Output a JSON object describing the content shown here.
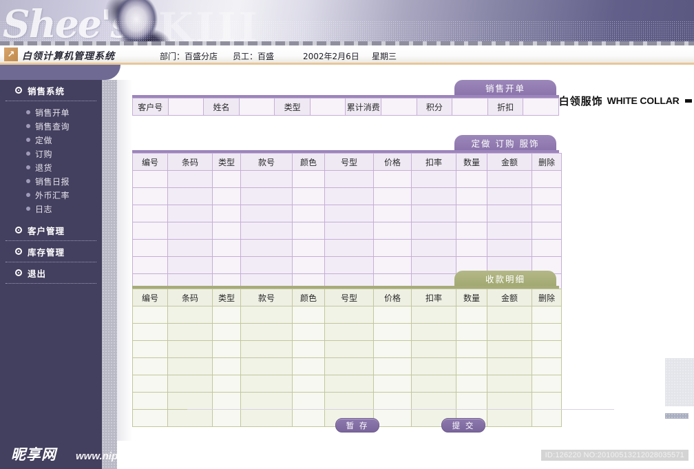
{
  "banner": {
    "script_text": "Shee's",
    "big_text": "KIII"
  },
  "header": {
    "app_title": "白领计算机管理系统",
    "department": "部门：百盛分店",
    "staff": "员工：百盛",
    "date": "2002年2月6日",
    "weekday": "星期三",
    "brand_cn": "白领服饰",
    "brand_en": "WHITE COLLAR",
    "logo_icon": "arrow-up-right-icon"
  },
  "sidebar": {
    "groups": [
      {
        "label": "销售系统",
        "icon": "radio-bullet-icon",
        "items": [
          {
            "label": "销售开单"
          },
          {
            "label": "销售查询"
          },
          {
            "label": "定做"
          },
          {
            "label": "订购"
          },
          {
            "label": "退货"
          },
          {
            "label": "销售日报"
          },
          {
            "label": "外币汇率"
          },
          {
            "label": "日志"
          }
        ]
      },
      {
        "label": "客户管理",
        "icon": "radio-bullet-icon",
        "items": []
      },
      {
        "label": "库存管理",
        "icon": "radio-bullet-icon",
        "items": []
      },
      {
        "label": "退出",
        "icon": "radio-bullet-icon",
        "items": []
      }
    ]
  },
  "main": {
    "customer_panel": {
      "tab_label": "销售开单",
      "fields": [
        {
          "label": "客户号",
          "value": ""
        },
        {
          "label": "姓名",
          "value": ""
        },
        {
          "label": "类型",
          "value": ""
        },
        {
          "label": "累计消费",
          "value": ""
        },
        {
          "label": "积分",
          "value": ""
        },
        {
          "label": "折扣",
          "value": ""
        }
      ]
    },
    "items_panel": {
      "tab_label": "定做 订购 服饰",
      "columns": [
        "编号",
        "条码",
        "类型",
        "款号",
        "颜色",
        "号型",
        "价格",
        "扣率",
        "数量",
        "金额",
        "删除"
      ],
      "rows": [
        [
          "",
          "",
          "",
          "",
          "",
          "",
          "",
          "",
          "",
          "",
          ""
        ],
        [
          "",
          "",
          "",
          "",
          "",
          "",
          "",
          "",
          "",
          "",
          ""
        ],
        [
          "",
          "",
          "",
          "",
          "",
          "",
          "",
          "",
          "",
          "",
          ""
        ],
        [
          "",
          "",
          "",
          "",
          "",
          "",
          "",
          "",
          "",
          "",
          ""
        ],
        [
          "",
          "",
          "",
          "",
          "",
          "",
          "",
          "",
          "",
          "",
          ""
        ],
        [
          "",
          "",
          "",
          "",
          "",
          "",
          "",
          "",
          "",
          "",
          ""
        ],
        [
          "",
          "",
          "",
          "",
          "",
          "",
          "",
          "",
          "",
          "",
          ""
        ]
      ]
    },
    "payment_panel": {
      "tab_label": "收款明细",
      "columns": [
        "编号",
        "条码",
        "类型",
        "款号",
        "颜色",
        "号型",
        "价格",
        "扣率",
        "数量",
        "金额",
        "删除"
      ],
      "rows": [
        [
          "",
          "",
          "",
          "",
          "",
          "",
          "",
          "",
          "",
          "",
          ""
        ],
        [
          "",
          "",
          "",
          "",
          "",
          "",
          "",
          "",
          "",
          "",
          ""
        ],
        [
          "",
          "",
          "",
          "",
          "",
          "",
          "",
          "",
          "",
          "",
          ""
        ],
        [
          "",
          "",
          "",
          "",
          "",
          "",
          "",
          "",
          "",
          "",
          ""
        ],
        [
          "",
          "",
          "",
          "",
          "",
          "",
          "",
          "",
          "",
          "",
          ""
        ],
        [
          "",
          "",
          "",
          "",
          "",
          "",
          "",
          "",
          "",
          "",
          ""
        ],
        [
          "",
          "",
          "",
          "",
          "",
          "",
          "",
          "",
          "",
          "",
          ""
        ]
      ]
    },
    "buttons": {
      "save_label": "暂 存",
      "submit_label": "提 交"
    }
  },
  "footer": {
    "watermark_cn": "昵享网",
    "watermark_url": "www.nipic.cn",
    "id_text": "ID:126220 NO:20100513212028035571"
  },
  "colors": {
    "sidebar_bg": "#433f5e",
    "purple_accent": "#8b74ab",
    "green_accent": "#a3a972",
    "header_rule": "#e8c79a"
  }
}
